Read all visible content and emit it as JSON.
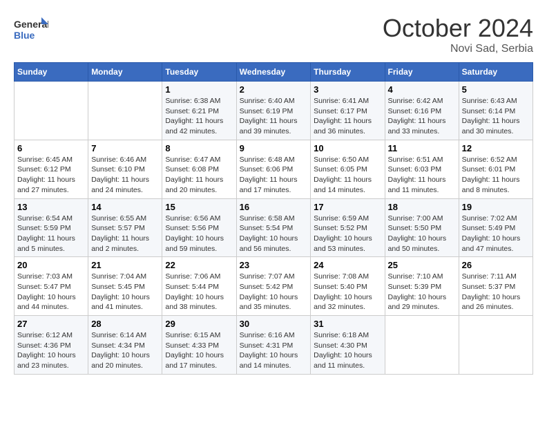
{
  "header": {
    "logo_text_general": "General",
    "logo_text_blue": "Blue",
    "month": "October 2024",
    "location": "Novi Sad, Serbia"
  },
  "days_of_week": [
    "Sunday",
    "Monday",
    "Tuesday",
    "Wednesday",
    "Thursday",
    "Friday",
    "Saturday"
  ],
  "weeks": [
    [
      {
        "day": "",
        "info": ""
      },
      {
        "day": "",
        "info": ""
      },
      {
        "day": "1",
        "info": "Sunrise: 6:38 AM\nSunset: 6:21 PM\nDaylight: 11 hours and 42 minutes."
      },
      {
        "day": "2",
        "info": "Sunrise: 6:40 AM\nSunset: 6:19 PM\nDaylight: 11 hours and 39 minutes."
      },
      {
        "day": "3",
        "info": "Sunrise: 6:41 AM\nSunset: 6:17 PM\nDaylight: 11 hours and 36 minutes."
      },
      {
        "day": "4",
        "info": "Sunrise: 6:42 AM\nSunset: 6:16 PM\nDaylight: 11 hours and 33 minutes."
      },
      {
        "day": "5",
        "info": "Sunrise: 6:43 AM\nSunset: 6:14 PM\nDaylight: 11 hours and 30 minutes."
      }
    ],
    [
      {
        "day": "6",
        "info": "Sunrise: 6:45 AM\nSunset: 6:12 PM\nDaylight: 11 hours and 27 minutes."
      },
      {
        "day": "7",
        "info": "Sunrise: 6:46 AM\nSunset: 6:10 PM\nDaylight: 11 hours and 24 minutes."
      },
      {
        "day": "8",
        "info": "Sunrise: 6:47 AM\nSunset: 6:08 PM\nDaylight: 11 hours and 20 minutes."
      },
      {
        "day": "9",
        "info": "Sunrise: 6:48 AM\nSunset: 6:06 PM\nDaylight: 11 hours and 17 minutes."
      },
      {
        "day": "10",
        "info": "Sunrise: 6:50 AM\nSunset: 6:05 PM\nDaylight: 11 hours and 14 minutes."
      },
      {
        "day": "11",
        "info": "Sunrise: 6:51 AM\nSunset: 6:03 PM\nDaylight: 11 hours and 11 minutes."
      },
      {
        "day": "12",
        "info": "Sunrise: 6:52 AM\nSunset: 6:01 PM\nDaylight: 11 hours and 8 minutes."
      }
    ],
    [
      {
        "day": "13",
        "info": "Sunrise: 6:54 AM\nSunset: 5:59 PM\nDaylight: 11 hours and 5 minutes."
      },
      {
        "day": "14",
        "info": "Sunrise: 6:55 AM\nSunset: 5:57 PM\nDaylight: 11 hours and 2 minutes."
      },
      {
        "day": "15",
        "info": "Sunrise: 6:56 AM\nSunset: 5:56 PM\nDaylight: 10 hours and 59 minutes."
      },
      {
        "day": "16",
        "info": "Sunrise: 6:58 AM\nSunset: 5:54 PM\nDaylight: 10 hours and 56 minutes."
      },
      {
        "day": "17",
        "info": "Sunrise: 6:59 AM\nSunset: 5:52 PM\nDaylight: 10 hours and 53 minutes."
      },
      {
        "day": "18",
        "info": "Sunrise: 7:00 AM\nSunset: 5:50 PM\nDaylight: 10 hours and 50 minutes."
      },
      {
        "day": "19",
        "info": "Sunrise: 7:02 AM\nSunset: 5:49 PM\nDaylight: 10 hours and 47 minutes."
      }
    ],
    [
      {
        "day": "20",
        "info": "Sunrise: 7:03 AM\nSunset: 5:47 PM\nDaylight: 10 hours and 44 minutes."
      },
      {
        "day": "21",
        "info": "Sunrise: 7:04 AM\nSunset: 5:45 PM\nDaylight: 10 hours and 41 minutes."
      },
      {
        "day": "22",
        "info": "Sunrise: 7:06 AM\nSunset: 5:44 PM\nDaylight: 10 hours and 38 minutes."
      },
      {
        "day": "23",
        "info": "Sunrise: 7:07 AM\nSunset: 5:42 PM\nDaylight: 10 hours and 35 minutes."
      },
      {
        "day": "24",
        "info": "Sunrise: 7:08 AM\nSunset: 5:40 PM\nDaylight: 10 hours and 32 minutes."
      },
      {
        "day": "25",
        "info": "Sunrise: 7:10 AM\nSunset: 5:39 PM\nDaylight: 10 hours and 29 minutes."
      },
      {
        "day": "26",
        "info": "Sunrise: 7:11 AM\nSunset: 5:37 PM\nDaylight: 10 hours and 26 minutes."
      }
    ],
    [
      {
        "day": "27",
        "info": "Sunrise: 6:12 AM\nSunset: 4:36 PM\nDaylight: 10 hours and 23 minutes."
      },
      {
        "day": "28",
        "info": "Sunrise: 6:14 AM\nSunset: 4:34 PM\nDaylight: 10 hours and 20 minutes."
      },
      {
        "day": "29",
        "info": "Sunrise: 6:15 AM\nSunset: 4:33 PM\nDaylight: 10 hours and 17 minutes."
      },
      {
        "day": "30",
        "info": "Sunrise: 6:16 AM\nSunset: 4:31 PM\nDaylight: 10 hours and 14 minutes."
      },
      {
        "day": "31",
        "info": "Sunrise: 6:18 AM\nSunset: 4:30 PM\nDaylight: 10 hours and 11 minutes."
      },
      {
        "day": "",
        "info": ""
      },
      {
        "day": "",
        "info": ""
      }
    ]
  ]
}
